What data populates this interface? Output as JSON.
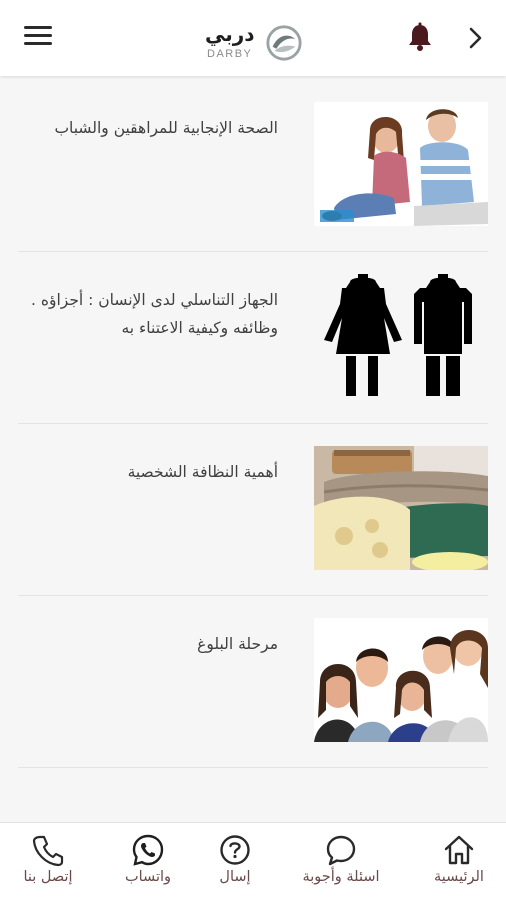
{
  "header": {
    "logo_ar": "دربي",
    "logo_en": "DARBY",
    "icons": {
      "menu": "hamburger-menu-icon",
      "notifications": "bell-icon",
      "back": "chevron-right-icon"
    },
    "accent_color": "#4a1a1e"
  },
  "items": [
    {
      "title": "الصحة الإنجابية للمراهقين والشباب",
      "image": "teens-photo"
    },
    {
      "title": "الجهاز التناسلي لدى الإنسان : أجزاؤه . وظائفه وكيفية الاعتناء به",
      "image": "male-female-figures"
    },
    {
      "title": "أهمية النظافة الشخصية",
      "image": "towels-soap-photo"
    },
    {
      "title": "مرحلة البلوغ",
      "image": "group-photo"
    }
  ],
  "bottom_nav": [
    {
      "label": "الرئيسية",
      "icon": "home-icon"
    },
    {
      "label": "اسئلة وأجوبة",
      "icon": "chat-bubble-icon"
    },
    {
      "label": "إسال",
      "icon": "question-circle-icon"
    },
    {
      "label": "واتساب",
      "icon": "whatsapp-icon"
    },
    {
      "label": "إتصل بنا",
      "icon": "phone-icon"
    }
  ]
}
